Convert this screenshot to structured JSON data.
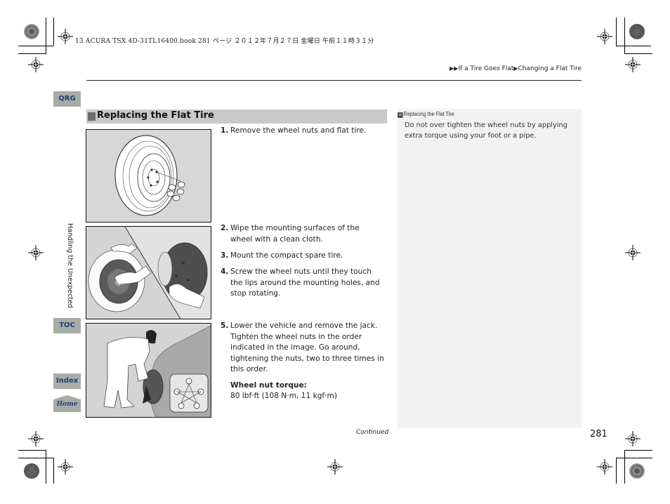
{
  "print_header": "13 ACURA TSX 4D-31TL16400.book  281 ページ  ２０１２年７月２７日  金曜日  午前１１時３１分",
  "breadcrumb": {
    "prefix_icon": "double-triangle-right",
    "items": [
      "If a Tire Goes Flat",
      "Changing a Flat Tire"
    ]
  },
  "side_nav": {
    "qrg": "QRG",
    "chapter": "Handling the Unexpected",
    "toc": "TOC",
    "index": "Index",
    "home": "Home"
  },
  "section": {
    "title": "Replacing the Flat Tire"
  },
  "steps": [
    {
      "num": "1.",
      "text": "Remove the wheel nuts and flat tire."
    },
    {
      "num": "2.",
      "text": "Wipe the mounting surfaces of the wheel with a clean cloth."
    },
    {
      "num": "3.",
      "text": "Mount the compact spare tire."
    },
    {
      "num": "4.",
      "text": "Screw the wheel nuts until they touch the lips around the mounting holes, and stop rotating."
    },
    {
      "num": "5.",
      "text": "Lower the vehicle and remove the jack. Tighten the wheel nuts in the order indicated in the image. Go around, tightening the nuts, two to three times in this order."
    }
  ],
  "torque": {
    "label": "Wheel nut torque:",
    "value": "80 lbf·ft (108 N·m, 11 kgf·m)"
  },
  "figures": [
    {
      "name": "tire-and-wheel-nuts-illustration"
    },
    {
      "name": "wiping-mounting-surfaces-illustration"
    },
    {
      "name": "tightening-nuts-star-pattern-illustration"
    }
  ],
  "note": {
    "icon": "»",
    "title": "Replacing the Flat Tire",
    "body": "Do not over tighten the wheel nuts by applying extra torque using your foot or a pipe."
  },
  "footer": {
    "continued": "Continued",
    "page_number": "281"
  },
  "colors": {
    "tab_bg": "#a9aca6",
    "tab_text": "#1e3f79",
    "section_bar": "#c9c9c9",
    "note_panel": "#f2f2f2"
  }
}
